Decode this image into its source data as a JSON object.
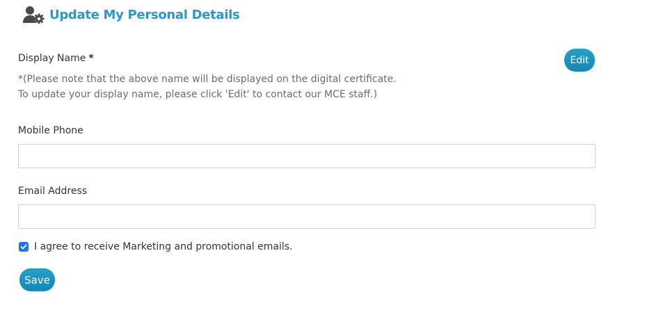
{
  "header": {
    "title": "Update My Personal Details",
    "icon": "user-gear-icon"
  },
  "display_name": {
    "label": "Display Name",
    "required_marker": "*",
    "note_line1": "*(Please note that the above name will be displayed on the digital certificate.",
    "note_line2": "To update your display name, please click 'Edit' to contact our MCE staff.)",
    "edit_label": "Edit"
  },
  "mobile_phone": {
    "label": "Mobile Phone",
    "value": "",
    "placeholder": ""
  },
  "email": {
    "label": "Email Address",
    "value": "",
    "placeholder": ""
  },
  "marketing_consent": {
    "label": "I agree to receive Marketing and promotional emails.",
    "checked": true
  },
  "save_label": "Save",
  "colors": {
    "title": "#2a97cf",
    "button": "#1c8bb8",
    "checkbox": "#1a73e8"
  }
}
